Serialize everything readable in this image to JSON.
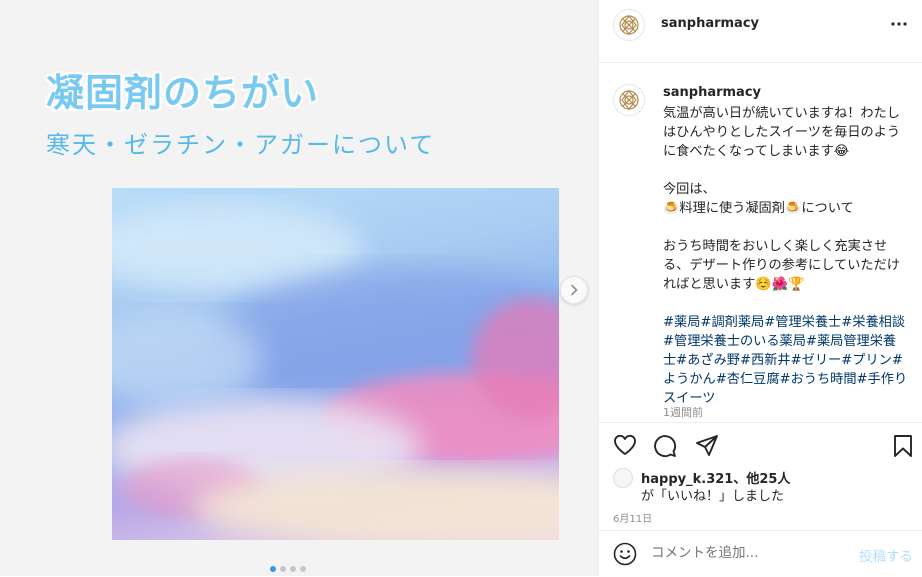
{
  "post_image": {
    "title": "凝固剤のちがい",
    "subtitle": "寒天・ゼラチン・アガーについて",
    "carousel_dots": 4,
    "active_dot": 0
  },
  "header": {
    "username": "sanpharmacy"
  },
  "caption": {
    "username": "sanpharmacy",
    "para1": "気温が高い日が続いていますね！わたしはひんやりとしたスイーツを毎日のように食べたくなってしまいます😂",
    "para2_line1": "今回は、",
    "para2_line2": "🍮料理に使う凝固剤🍮について",
    "para3": "おうち時間をおいしく楽しく充実させる、デザート作りの参考にしていただければと思います☺️🌺🏆",
    "hashtags": "#薬局#調剤薬局#管理栄養士#栄養相談#管理栄養士のいる薬局#薬局管理栄養士#あざみ野#西新井#ゼリー#プリン#ようかん#杏仁豆腐#おうち時間#手作りスイーツ",
    "time": "1週間前"
  },
  "likes": {
    "line1": "happy_k.321、他25人",
    "line2": "が「いいね！」しました"
  },
  "post_date": "6月11日",
  "comment": {
    "placeholder": "コメントを追加...",
    "post_label": "投稿する"
  },
  "colors": {
    "title": "#79c9f1",
    "hashtag": "#00376b",
    "post_button": "#b2dffc",
    "media_background": "#f3f3f3"
  }
}
